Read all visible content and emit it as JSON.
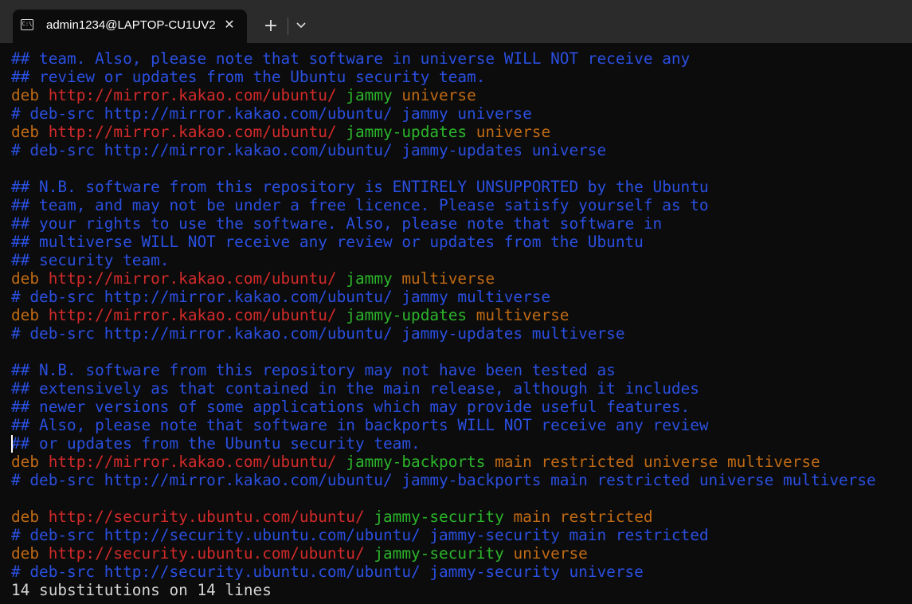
{
  "window": {
    "tab_title": "admin1234@LAPTOP-CU1UV2",
    "tab_icon_glyph": "C:\\",
    "close_glyph": "✕",
    "new_tab_glyph": "+",
    "icons": [
      "terminal-icon",
      "close-icon",
      "plus-icon",
      "chevron-down-icon"
    ]
  },
  "colors": {
    "comment": "#2a4fe0",
    "keyword": "#c06a14",
    "url": "#d22a2a",
    "distribution": "#2bb52b",
    "component": "#c06a14",
    "status": "#d4d4d4",
    "background": "#0c0c0c"
  },
  "terminal": {
    "lines": [
      [
        {
          "t": "cmt",
          "s": "## team. Also, please note that software in universe WILL NOT receive any"
        }
      ],
      [
        {
          "t": "cmt",
          "s": "## review or updates from the Ubuntu security team."
        }
      ],
      [
        {
          "t": "kw",
          "s": "deb "
        },
        {
          "t": "url",
          "s": "http://mirror.kakao.com/ubuntu/"
        },
        {
          "t": "kw",
          "s": " "
        },
        {
          "t": "dist",
          "s": "jammy"
        },
        {
          "t": "comp",
          "s": " universe"
        }
      ],
      [
        {
          "t": "cmt",
          "s": "# deb-src http://mirror.kakao.com/ubuntu/ jammy universe"
        }
      ],
      [
        {
          "t": "kw",
          "s": "deb "
        },
        {
          "t": "url",
          "s": "http://mirror.kakao.com/ubuntu/"
        },
        {
          "t": "kw",
          "s": " "
        },
        {
          "t": "dist",
          "s": "jammy-updates"
        },
        {
          "t": "comp",
          "s": " universe"
        }
      ],
      [
        {
          "t": "cmt",
          "s": "# deb-src http://mirror.kakao.com/ubuntu/ jammy-updates universe"
        }
      ],
      [],
      [
        {
          "t": "cmt",
          "s": "## N.B. software from this repository is ENTIRELY UNSUPPORTED by the Ubuntu"
        }
      ],
      [
        {
          "t": "cmt",
          "s": "## team, and may not be under a free licence. Please satisfy yourself as to"
        }
      ],
      [
        {
          "t": "cmt",
          "s": "## your rights to use the software. Also, please note that software in"
        }
      ],
      [
        {
          "t": "cmt",
          "s": "## multiverse WILL NOT receive any review or updates from the Ubuntu"
        }
      ],
      [
        {
          "t": "cmt",
          "s": "## security team."
        }
      ],
      [
        {
          "t": "kw",
          "s": "deb "
        },
        {
          "t": "url",
          "s": "http://mirror.kakao.com/ubuntu/"
        },
        {
          "t": "kw",
          "s": " "
        },
        {
          "t": "dist",
          "s": "jammy"
        },
        {
          "t": "comp",
          "s": " multiverse"
        }
      ],
      [
        {
          "t": "cmt",
          "s": "# deb-src http://mirror.kakao.com/ubuntu/ jammy multiverse"
        }
      ],
      [
        {
          "t": "kw",
          "s": "deb "
        },
        {
          "t": "url",
          "s": "http://mirror.kakao.com/ubuntu/"
        },
        {
          "t": "kw",
          "s": " "
        },
        {
          "t": "dist",
          "s": "jammy-updates"
        },
        {
          "t": "comp",
          "s": " multiverse"
        }
      ],
      [
        {
          "t": "cmt",
          "s": "# deb-src http://mirror.kakao.com/ubuntu/ jammy-updates multiverse"
        }
      ],
      [],
      [
        {
          "t": "cmt",
          "s": "## N.B. software from this repository may not have been tested as"
        }
      ],
      [
        {
          "t": "cmt",
          "s": "## extensively as that contained in the main release, although it includes"
        }
      ],
      [
        {
          "t": "cmt",
          "s": "## newer versions of some applications which may provide useful features."
        }
      ],
      [
        {
          "t": "cmt",
          "s": "## Also, please note that software in backports WILL NOT receive any review"
        }
      ],
      [
        {
          "t": "cmt",
          "s": "## or updates from the Ubuntu security team."
        }
      ],
      [
        {
          "t": "kw",
          "s": "deb "
        },
        {
          "t": "url",
          "s": "http://mirror.kakao.com/ubuntu/"
        },
        {
          "t": "kw",
          "s": " "
        },
        {
          "t": "dist",
          "s": "jammy-backports"
        },
        {
          "t": "comp",
          "s": " main restricted universe multiverse"
        }
      ],
      [
        {
          "t": "cmt",
          "s": "# deb-src http://mirror.kakao.com/ubuntu/ jammy-backports main restricted universe multiverse"
        }
      ],
      [],
      [
        {
          "t": "kw",
          "s": "deb "
        },
        {
          "t": "url",
          "s": "http://security.ubuntu.com/ubuntu/"
        },
        {
          "t": "kw",
          "s": " "
        },
        {
          "t": "dist",
          "s": "jammy-security"
        },
        {
          "t": "comp",
          "s": " main restricted"
        }
      ],
      [
        {
          "t": "cmt",
          "s": "# deb-src http://security.ubuntu.com/ubuntu/ jammy-security main restricted"
        }
      ],
      [
        {
          "t": "kw",
          "s": "deb "
        },
        {
          "t": "url",
          "s": "http://security.ubuntu.com/ubuntu/"
        },
        {
          "t": "kw",
          "s": " "
        },
        {
          "t": "dist",
          "s": "jammy-security"
        },
        {
          "t": "comp",
          "s": " universe"
        }
      ],
      [
        {
          "t": "cmt",
          "s": "# deb-src http://security.ubuntu.com/ubuntu/ jammy-security universe"
        }
      ]
    ],
    "status_line": "14 substitutions on 14 lines"
  }
}
